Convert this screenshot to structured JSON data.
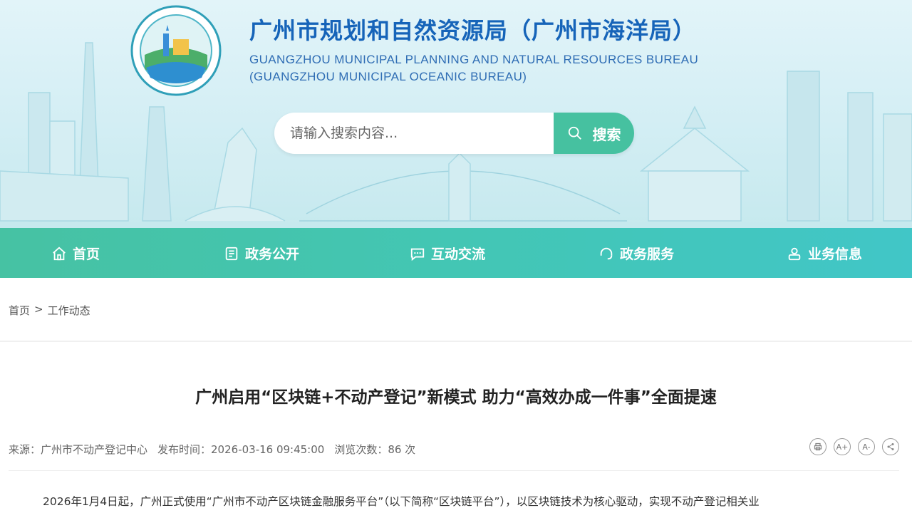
{
  "site": {
    "title": "广州市规划和自然资源局（广州市海洋局）",
    "title_en_line1": "GUANGZHOU MUNICIPAL PLANNING AND NATURAL RESOURCES BUREAU",
    "title_en_line2": "(GUANGZHOU MUNICIPAL OCEANIC BUREAU)"
  },
  "search": {
    "placeholder": "请输入搜索内容...",
    "button_label": "搜索"
  },
  "nav": {
    "items": [
      {
        "label": "首页",
        "icon": "home-icon"
      },
      {
        "label": "政务公开",
        "icon": "document-icon"
      },
      {
        "label": "互动交流",
        "icon": "chat-icon"
      },
      {
        "label": "政务服务",
        "icon": "headset-icon"
      },
      {
        "label": "业务信息",
        "icon": "user-info-icon"
      }
    ]
  },
  "breadcrumb": {
    "home": "首页",
    "separator": ">",
    "current": "工作动态"
  },
  "article": {
    "title": "广州启用“区块链+不动产登记”新模式 助力“高效办成一件事”全面提速",
    "source": "来源：广州市不动产登记中心",
    "publish_time": "发布时间：2026-03-16 09:45:00",
    "views": "浏览次数：86 次",
    "body_first_line": "2026年1月4日起，广州正式使用“广州市不动产区块链金融服务平台”（以下简称“区块链平台”），以区块链技术为核心驱动，实现不动产登记相关业"
  },
  "tools": {
    "print": "print-icon",
    "font_large": "A+",
    "font_small": "A-",
    "share": "share-icon"
  },
  "colors": {
    "title_blue": "#1664b9",
    "nav_green": "#46c2a3",
    "search_btn": "#46c1a0"
  }
}
